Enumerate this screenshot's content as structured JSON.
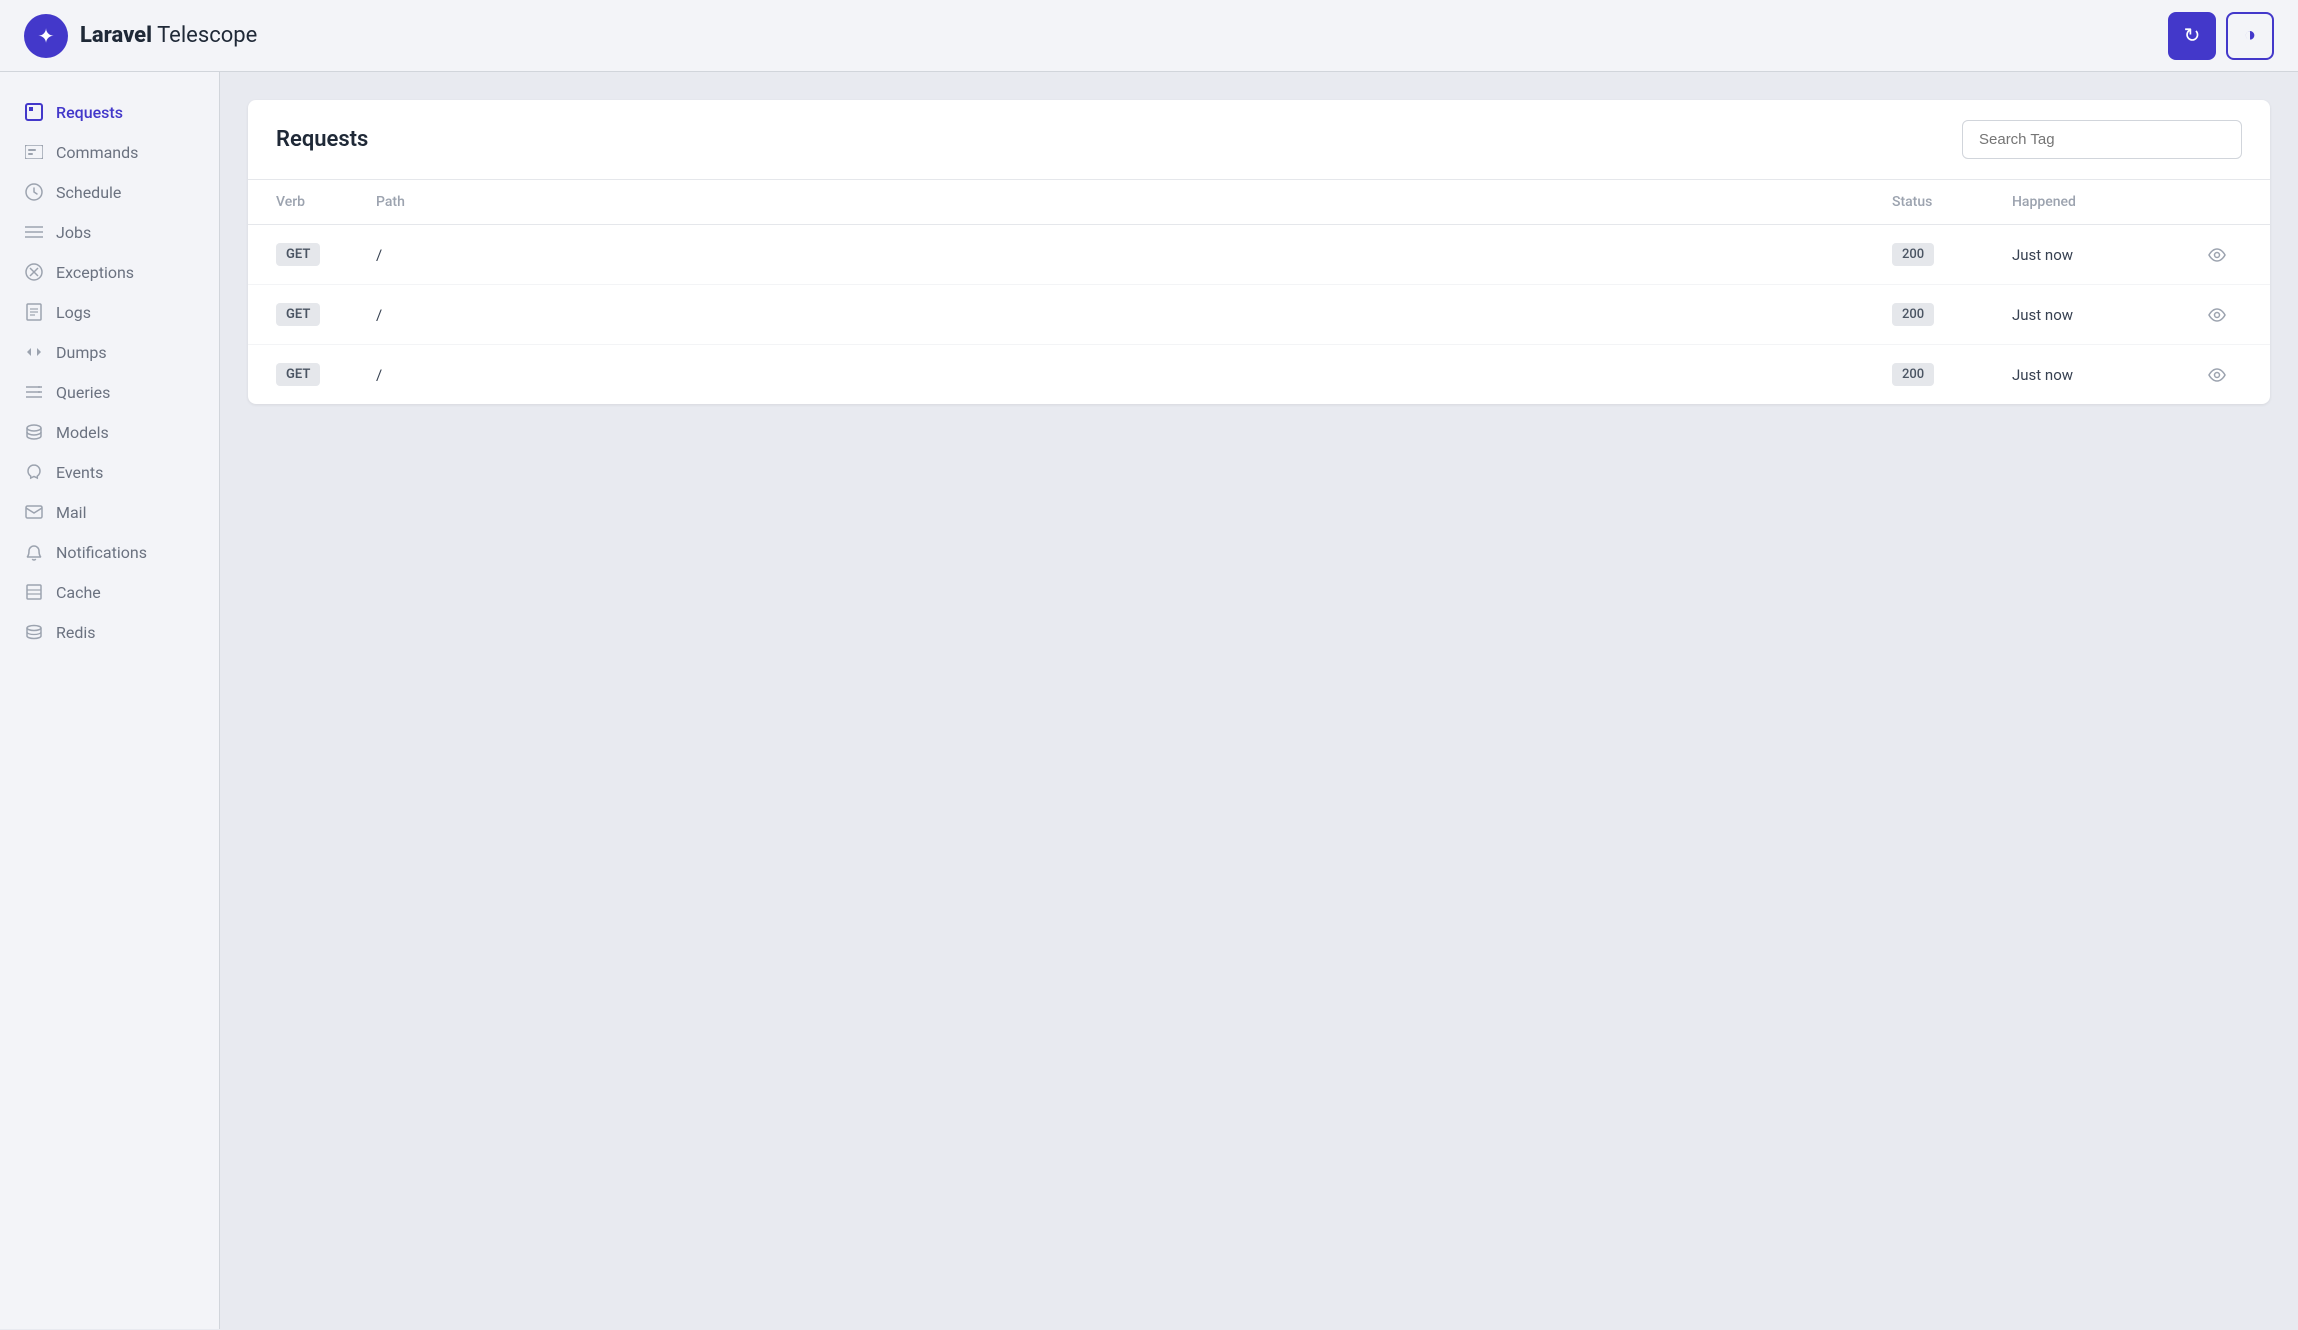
{
  "app": {
    "name_bold": "Laravel",
    "name_regular": " Telescope",
    "logo_icon": "✦"
  },
  "header": {
    "refresh_label": "↻",
    "theme_label": "◑"
  },
  "sidebar": {
    "items": [
      {
        "id": "requests",
        "label": "Requests",
        "icon": "▣",
        "active": true
      },
      {
        "id": "commands",
        "label": "Commands",
        "icon": "▭"
      },
      {
        "id": "schedule",
        "label": "Schedule",
        "icon": "🕐"
      },
      {
        "id": "jobs",
        "label": "Jobs",
        "icon": "≡"
      },
      {
        "id": "exceptions",
        "label": "Exceptions",
        "icon": "✿"
      },
      {
        "id": "logs",
        "label": "Logs",
        "icon": "▤"
      },
      {
        "id": "dumps",
        "label": "Dumps",
        "icon": "<>"
      },
      {
        "id": "queries",
        "label": "Queries",
        "icon": "≡"
      },
      {
        "id": "models",
        "label": "Models",
        "icon": "◈"
      },
      {
        "id": "events",
        "label": "Events",
        "icon": "🎧"
      },
      {
        "id": "mail",
        "label": "Mail",
        "icon": "✉"
      },
      {
        "id": "notifications",
        "label": "Notifications",
        "icon": "📣"
      },
      {
        "id": "cache",
        "label": "Cache",
        "icon": "▤"
      },
      {
        "id": "redis",
        "label": "Redis",
        "icon": "◈"
      }
    ]
  },
  "main": {
    "title": "Requests",
    "search_placeholder": "Search Tag",
    "table": {
      "columns": [
        "Verb",
        "Path",
        "Status",
        "Happened",
        ""
      ],
      "rows": [
        {
          "verb": "GET",
          "path": "/",
          "status": "200",
          "happened": "Just now"
        },
        {
          "verb": "GET",
          "path": "/",
          "status": "200",
          "happened": "Just now"
        },
        {
          "verb": "GET",
          "path": "/",
          "status": "200",
          "happened": "Just now"
        }
      ]
    }
  }
}
